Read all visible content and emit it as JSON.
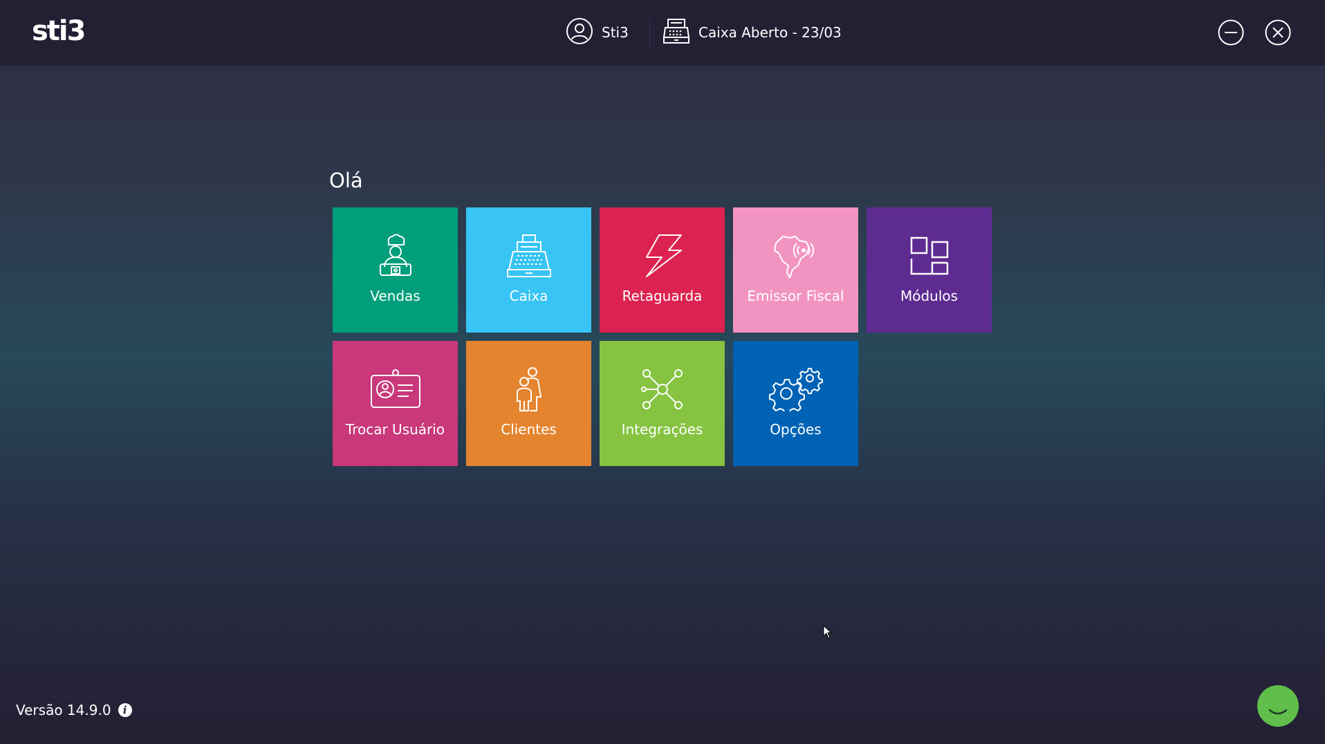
{
  "header": {
    "logo": "sti3",
    "user_name": "Sti3",
    "cashier_status": "Caixa Aberto - 23/03",
    "icons": {
      "user": "user-circle-icon",
      "cashier": "cash-register-icon",
      "minimize": "minimize-icon",
      "close": "close-icon"
    }
  },
  "main": {
    "greeting": "Olá",
    "tiles": [
      {
        "label": "Vendas",
        "color": "#009e7a",
        "icon": "chef-icon"
      },
      {
        "label": "Caixa",
        "color": "#38c4f4",
        "icon": "cash-register-icon"
      },
      {
        "label": "Retaguarda",
        "color": "#dc2250",
        "icon": "lightning-icon"
      },
      {
        "label": "Emissor Fiscal",
        "color": "#f294c1",
        "icon": "brazil-map-signal-icon"
      },
      {
        "label": "Módulos",
        "color": "#5e2b91",
        "icon": "modules-icon"
      },
      {
        "label": "Trocar Usuário",
        "color": "#c9387a",
        "icon": "id-card-icon"
      },
      {
        "label": "Clientes",
        "color": "#e4842f",
        "icon": "people-icon"
      },
      {
        "label": "Integrações",
        "color": "#85c341",
        "icon": "network-icon"
      },
      {
        "label": "Opções",
        "color": "#0062b4",
        "icon": "gears-icon"
      }
    ]
  },
  "footer": {
    "version": "Versão 14.9.0",
    "info_icon": "info-icon",
    "chat_icon": "chat-icon"
  }
}
